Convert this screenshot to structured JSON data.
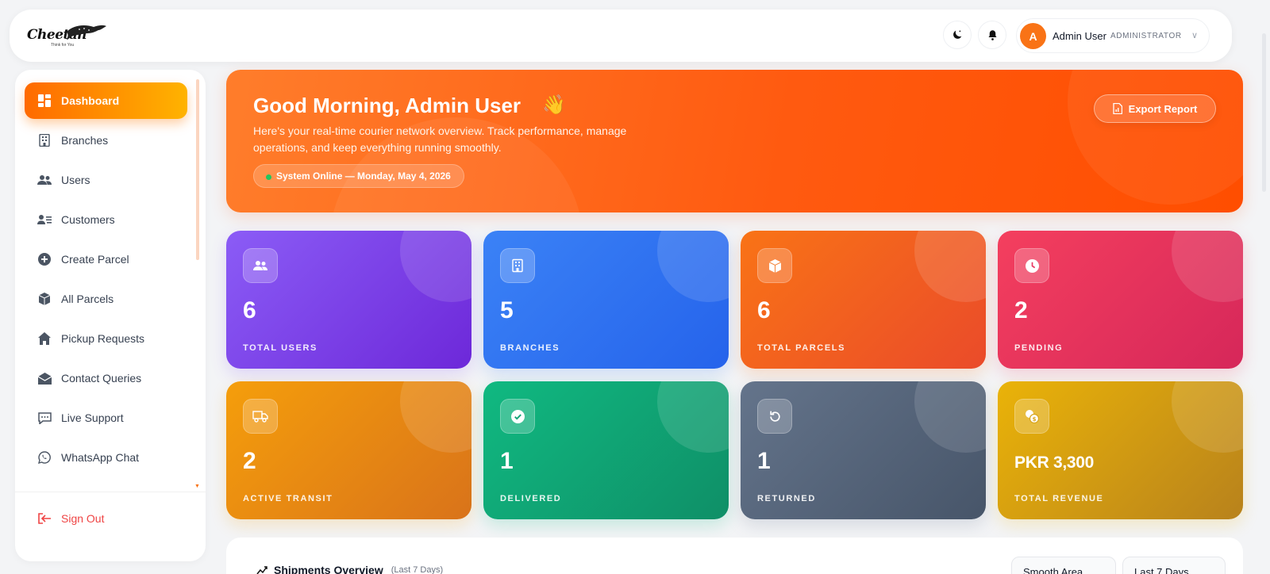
{
  "brand": {
    "name": "Cheetah",
    "tagline": "Think for You"
  },
  "header": {
    "user_initial": "A",
    "user_name": "Admin User",
    "user_role": "ADMINISTRATOR"
  },
  "sidebar": {
    "items": [
      {
        "label": "Dashboard",
        "icon": "dashboard-icon",
        "active": true
      },
      {
        "label": "Branches",
        "icon": "building-icon"
      },
      {
        "label": "Users",
        "icon": "users-icon"
      },
      {
        "label": "Customers",
        "icon": "customer-card-icon"
      },
      {
        "label": "Create Parcel",
        "icon": "plus-circle-icon"
      },
      {
        "label": "All Parcels",
        "icon": "box-icon"
      },
      {
        "label": "Pickup Requests",
        "icon": "house-icon"
      },
      {
        "label": "Contact Queries",
        "icon": "envelope-icon"
      },
      {
        "label": "Live Support",
        "icon": "chat-icon"
      },
      {
        "label": "WhatsApp Chat",
        "icon": "whatsapp-icon"
      }
    ],
    "sign_out": "Sign Out"
  },
  "hero": {
    "title": "Good Morning, Admin User",
    "emoji": "👋",
    "subtitle": "Here's your real-time courier network overview. Track performance, manage operations, and keep everything running smoothly.",
    "status": "System Online — Monday, May 4, 2026",
    "export_label": "Export Report"
  },
  "stats": [
    {
      "value": "6",
      "label": "TOTAL USERS",
      "icon": "users-icon",
      "from": "#8b5cf6",
      "to": "#6d28d9"
    },
    {
      "value": "5",
      "label": "BRANCHES",
      "icon": "building-icon",
      "from": "#3b82f6",
      "to": "#2563eb"
    },
    {
      "value": "6",
      "label": "TOTAL PARCELS",
      "icon": "box-icon",
      "from": "#f97316",
      "to": "#ea4b2a"
    },
    {
      "value": "2",
      "label": "PENDING",
      "icon": "clock-icon",
      "from": "#f43f5e",
      "to": "#d6275a"
    },
    {
      "value": "2",
      "label": "ACTIVE TRANSIT",
      "icon": "truck-icon",
      "from": "#f59e0b",
      "to": "#d9731a"
    },
    {
      "value": "1",
      "label": "DELIVERED",
      "icon": "check-circle-icon",
      "from": "#10b981",
      "to": "#0f8f67"
    },
    {
      "value": "1",
      "label": "RETURNED",
      "icon": "rotate-icon",
      "from": "#64748b",
      "to": "#475569"
    },
    {
      "value": "PKR 3,300",
      "label": "TOTAL REVENUE",
      "icon": "coins-icon",
      "from": "#eab308",
      "to": "#b8821c"
    }
  ],
  "chart_panel": {
    "title": "Shipments Overview",
    "subtitle": "(Last 7 Days)",
    "chart_type_select": "Smooth Area",
    "range_select": "Last 7 Days"
  }
}
